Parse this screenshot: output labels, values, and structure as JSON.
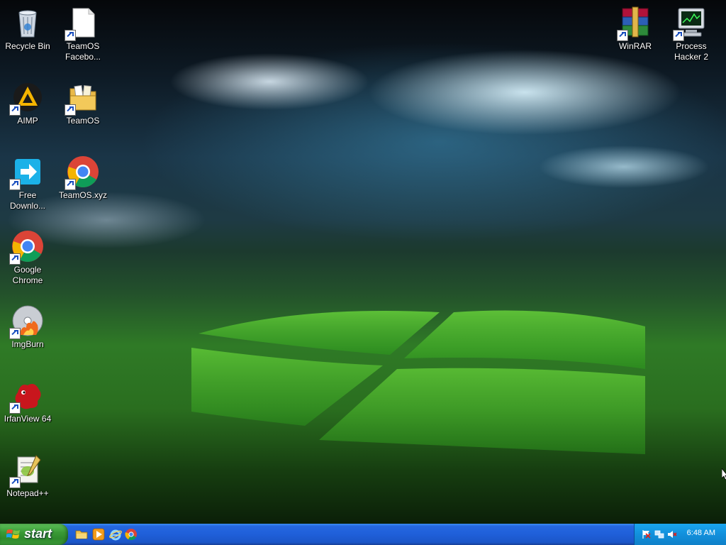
{
  "desktop": {
    "icons": [
      {
        "label": "Recycle Bin",
        "icon": "recycle-bin-icon"
      },
      {
        "label": "TeamOS Facebo...",
        "icon": "document-icon"
      },
      {
        "label": "AIMP",
        "icon": "aimp-icon"
      },
      {
        "label": "TeamOS",
        "icon": "folder-icon"
      },
      {
        "label": "Free Downlo...",
        "icon": "free-download-manager-icon"
      },
      {
        "label": "TeamOS.xyz",
        "icon": "chrome-icon"
      },
      {
        "label": "Google Chrome",
        "icon": "chrome-icon"
      },
      {
        "label": "ImgBurn",
        "icon": "imgburn-icon"
      },
      {
        "label": "IrfanView 64",
        "icon": "irfanview-icon"
      },
      {
        "label": "Notepad++",
        "icon": "notepad-plus-plus-icon"
      },
      {
        "label": "WinRAR",
        "icon": "winrar-icon"
      },
      {
        "label": "Process Hacker 2",
        "icon": "process-hacker-icon"
      }
    ]
  },
  "taskbar": {
    "start_label": "start",
    "quick_launch": [
      "explorer-icon",
      "media-player-icon",
      "internet-explorer-icon",
      "chrome-icon"
    ],
    "tray": {
      "icons": [
        "action-center-flag-icon",
        "network-icon",
        "volume-muted-icon"
      ],
      "clock": "6:48 AM"
    }
  },
  "colors": {
    "taskbar_blue": "#1f5fd9",
    "start_green": "#3a9a36",
    "tray_blue": "#1290dc"
  }
}
